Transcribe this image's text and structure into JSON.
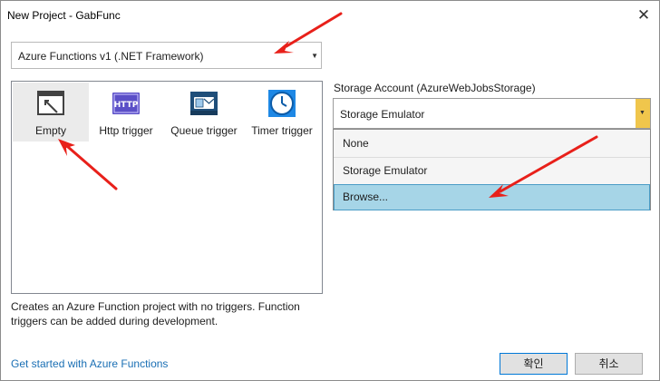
{
  "window": {
    "title": "New Project - GabFunc",
    "close_symbol": "✕"
  },
  "framework_select": {
    "value": "Azure Functions v1 (.NET Framework)"
  },
  "templates": [
    {
      "label": "Empty",
      "icon": "empty-template-icon",
      "selected": true
    },
    {
      "label": "Http trigger",
      "icon": "http-trigger-icon",
      "badge": "HTTP"
    },
    {
      "label": "Queue trigger",
      "icon": "queue-trigger-icon"
    },
    {
      "label": "Timer trigger",
      "icon": "timer-trigger-icon"
    }
  ],
  "description": {
    "line1": "Creates an Azure Function project with no triggers.  Function",
    "line2": "triggers can be added during development."
  },
  "get_started_link": "Get started with Azure Functions",
  "storage": {
    "label": "Storage Account (AzureWebJobsStorage)",
    "value": "Storage Emulator",
    "options": [
      "None",
      "Storage Emulator",
      "Browse..."
    ],
    "highlighted": "Browse..."
  },
  "buttons": {
    "ok": "확인",
    "cancel": "취소"
  },
  "colors": {
    "accent": "#0078d7",
    "arrow": "#e8201a",
    "highlight": "#a6d5e7",
    "combo_button": "#f0c64c",
    "link": "#1a6fb4",
    "http_icon": "#5b4fc7",
    "queue_icon": "#1f4e79",
    "timer_icon": "#1e88e5"
  }
}
